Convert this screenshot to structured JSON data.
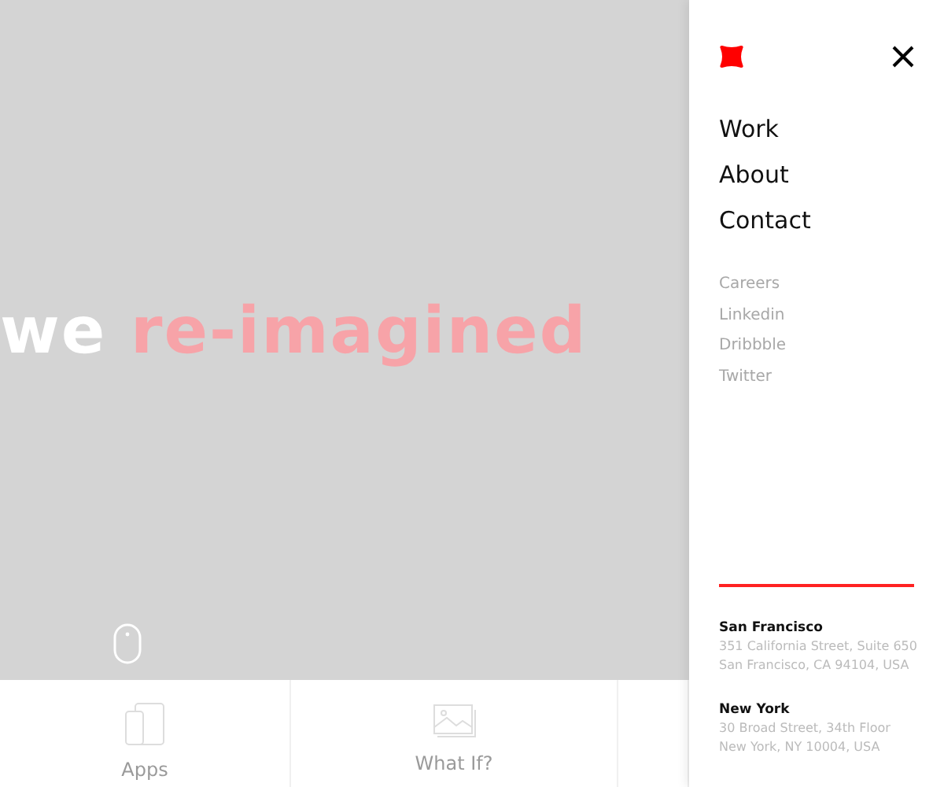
{
  "hero": {
    "headline": [
      {
        "text": "we",
        "kind": "plain"
      },
      {
        "text": "re-imagined",
        "kind": "accent"
      }
    ]
  },
  "tiles": [
    {
      "label": "Apps",
      "kind": "devices"
    },
    {
      "label": "What If?",
      "kind": "gallery"
    },
    {
      "kind": "empty"
    }
  ],
  "menu": {
    "primary": [
      "Work",
      "About",
      "Contact"
    ],
    "secondary": [
      "Careers",
      "Linkedin",
      "Dribbble",
      "Twitter"
    ],
    "offices": [
      {
        "city": "San Francisco",
        "lines": [
          "351 California Street, Suite 650",
          "San Francisco, CA 94104, USA"
        ]
      },
      {
        "city": "New York",
        "lines": [
          "30 Broad Street, 34th Floor",
          "New York, NY 10004, USA"
        ]
      }
    ]
  }
}
